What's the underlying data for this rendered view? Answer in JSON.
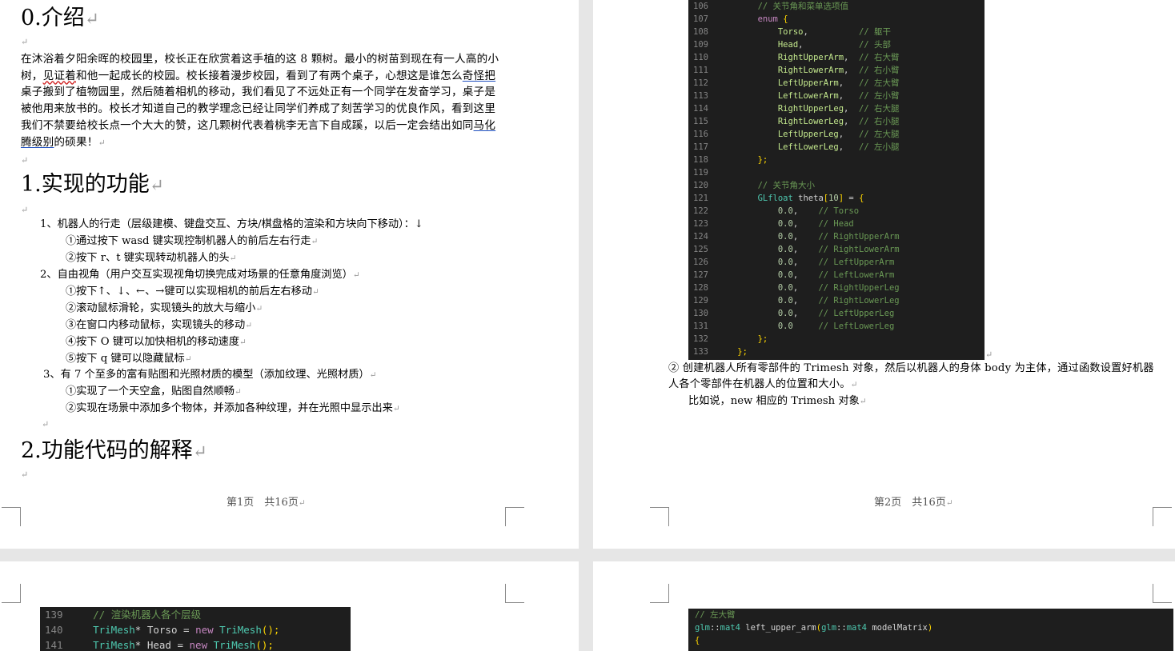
{
  "page1": {
    "h_intro": "0.介绍",
    "intro_text_parts": [
      "在沐浴着夕阳余晖的校园里，校长正在欣赏着这手植的这 8 颗树。最小的树苗到现在有一人高的小树，",
      "见证着",
      "和他一起成长的校园。校长接着漫步校园，看到了有两个桌子，心想这是谁怎么",
      "奇怪把",
      "桌子搬到了植物园里，然后随着相机的移动，我们看见了不远处正有一个同学在发奋学习，桌子是被他用来放书的。校长才知道自己的教学理念已经让同学们养成了刻苦学习的优良作风，看到这里我们不禁要给校长点一个大大的赞，这几颗树代表着桃李无言下自成蹊，以后一定会结出如同",
      "马化腾级别",
      "的硕果！"
    ],
    "h_features": "1.实现的功能",
    "items": [
      "1、机器人的行走（层级建模、键盘交互、方块/棋盘格的渲染和方块向下移动）：↓",
      "①通过按下 wasd 键实现控制机器人的前后左右行走",
      "②按下 r、t 键实现转动机器人的头",
      "2、自由视角（用户交互实现视角切换完成对场景的任意角度浏览）",
      "①按下↑、↓、←、→键可以实现相机的前后左右移动",
      "②滚动鼠标滑轮，实现镜头的放大与缩小",
      "③在窗口内移动鼠标，实现镜头的移动",
      "④按下 O 键可以加快相机的移动速度",
      "⑤按下 q 键可以隐藏鼠标",
      "3、有 7 个至多的富有贴图和光照材质的模型（添加纹理、光照材质）",
      "①实现了一个天空盒，贴图自然顺畅",
      "②实现在场景中添加多个物体，并添加各种纹理，并在光照中显示出来"
    ],
    "h_code": "2.功能代码的解释",
    "footer": "第1页　共16页"
  },
  "page2": {
    "code_lines": [
      {
        "n": "106",
        "t": "        // 关节角和菜单选项值"
      },
      {
        "n": "107",
        "t": "        enum {"
      },
      {
        "n": "108",
        "t": "            Torso,          // 躯干"
      },
      {
        "n": "109",
        "t": "            Head,           // 头部"
      },
      {
        "n": "110",
        "t": "            RightUpperArm,  // 右大臂"
      },
      {
        "n": "111",
        "t": "            RightLowerArm,  // 右小臂"
      },
      {
        "n": "112",
        "t": "            LeftUpperArm,   // 左大臂"
      },
      {
        "n": "113",
        "t": "            LeftLowerArm,   // 左小臂"
      },
      {
        "n": "114",
        "t": "            RightUpperLeg,  // 右大腿"
      },
      {
        "n": "115",
        "t": "            RightLowerLeg,  // 右小腿"
      },
      {
        "n": "116",
        "t": "            LeftUpperLeg,   // 左大腿"
      },
      {
        "n": "117",
        "t": "            LeftLowerLeg,   // 左小腿"
      },
      {
        "n": "118",
        "t": "        };"
      },
      {
        "n": "119",
        "t": ""
      },
      {
        "n": "120",
        "t": "        // 关节角大小"
      },
      {
        "n": "121",
        "t": "        GLfloat theta[10] = {"
      },
      {
        "n": "122",
        "t": "            0.0,    // Torso"
      },
      {
        "n": "123",
        "t": "            0.0,    // Head"
      },
      {
        "n": "124",
        "t": "            0.0,    // RightUpperArm"
      },
      {
        "n": "125",
        "t": "            0.0,    // RightLowerArm"
      },
      {
        "n": "126",
        "t": "            0.0,    // LeftUpperArm"
      },
      {
        "n": "127",
        "t": "            0.0,    // LeftLowerArm"
      },
      {
        "n": "128",
        "t": "            0.0,    // RightUpperLeg"
      },
      {
        "n": "129",
        "t": "            0.0,    // RightLowerLeg"
      },
      {
        "n": "130",
        "t": "            0.0,    // LeftUpperLeg"
      },
      {
        "n": "131",
        "t": "            0.0     // LeftLowerLeg"
      },
      {
        "n": "132",
        "t": "        };"
      },
      {
        "n": "133",
        "t": "    };"
      }
    ],
    "para_a": "② 创建机器人所有零部件的 Trimesh 对象，然后以机器人的身体 body 为主体，通过函数设置好机器人各个零部件在机器人的位置和大小。",
    "para_b": "比如说，new 相应的 Trimesh 对象",
    "footer": "第2页　共16页"
  },
  "page3": {
    "code_lines": [
      {
        "n": "139",
        "t": "    // 渲染机器人各个层级"
      },
      {
        "n": "140",
        "t": "    TriMesh* Torso = new TriMesh();"
      },
      {
        "n": "141",
        "t": "    TriMesh* Head = new TriMesh();"
      }
    ]
  },
  "page4": {
    "code_lines": [
      {
        "t": "// 左大臂"
      },
      {
        "t": "glm::mat4 left_upper_arm(glm::mat4 modelMatrix)"
      },
      {
        "t": "{"
      }
    ]
  }
}
